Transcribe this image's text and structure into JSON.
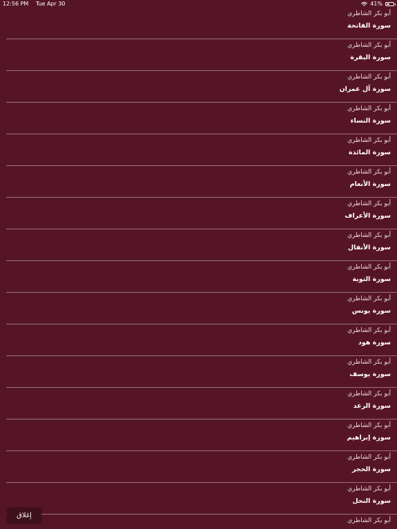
{
  "status_bar": {
    "time": "12:56 PM",
    "date": "Tue Apr 30",
    "battery_percent_text": "41%",
    "battery_level": 0.41,
    "wifi_icon": "wifi-icon",
    "battery_icon": "battery-icon"
  },
  "list": {
    "items": [
      {
        "reciter": "أبو بكر الشاطري",
        "surah": "سورة الفاتحة"
      },
      {
        "reciter": "أبو بكر الشاطري",
        "surah": "سورة البقرة"
      },
      {
        "reciter": "أبو بكر الشاطري",
        "surah": "سورة آل عمران"
      },
      {
        "reciter": "أبو بكر الشاطري",
        "surah": "سورة النساء"
      },
      {
        "reciter": "أبو بكر الشاطري",
        "surah": "سورة المائدة"
      },
      {
        "reciter": "أبو بكر الشاطري",
        "surah": "سورة الأنعام"
      },
      {
        "reciter": "أبو بكر الشاطري",
        "surah": "سورة الأعراف"
      },
      {
        "reciter": "أبو بكر الشاطري",
        "surah": "سورة الأنفال"
      },
      {
        "reciter": "أبو بكر الشاطري",
        "surah": "سورة التوبة"
      },
      {
        "reciter": "أبو بكر الشاطري",
        "surah": "سورة يونس"
      },
      {
        "reciter": "أبو بكر الشاطري",
        "surah": "سورة هود"
      },
      {
        "reciter": "أبو بكر الشاطري",
        "surah": "سورة يوسف"
      },
      {
        "reciter": "أبو بكر الشاطري",
        "surah": "سورة الرعد"
      },
      {
        "reciter": "أبو بكر الشاطري",
        "surah": "سورة إبراهيم"
      },
      {
        "reciter": "أبو بكر الشاطري",
        "surah": "سورة الحجر"
      },
      {
        "reciter": "أبو بكر الشاطري",
        "surah": "سورة النحل"
      },
      {
        "reciter": "أبو بكر الشاطري",
        "surah": ""
      }
    ]
  },
  "close_button": {
    "label": "إغلاق"
  },
  "colors": {
    "background": "#561527",
    "separator": "#9a7480",
    "button_background": "#3e0f1c",
    "text": "#ffffff"
  }
}
